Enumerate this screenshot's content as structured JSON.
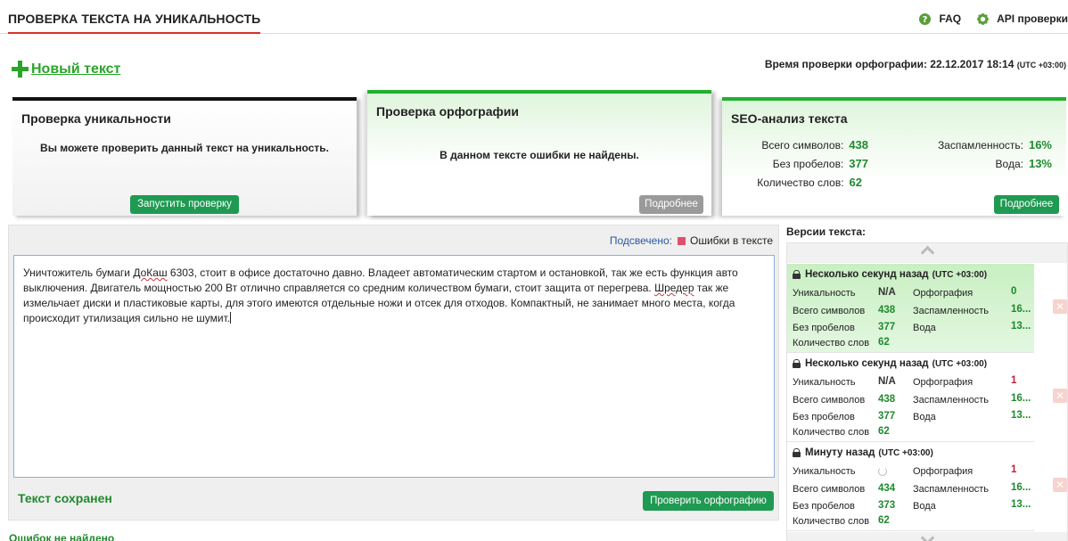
{
  "header": {
    "title": "ПРОВЕРКА ТЕКСТА НА УНИКАЛЬНОСТЬ",
    "links": [
      {
        "label": "FAQ",
        "icon": "question-icon"
      },
      {
        "label": "API проверки",
        "icon": "gear-icon"
      }
    ]
  },
  "new_text": {
    "label": "Новый текст",
    "icon": "plus-icon"
  },
  "spell_time": {
    "label": "Время проверки орфографии: 22.12.2017 18:14",
    "utc": "(UTC +03:00)"
  },
  "cards": {
    "unique": {
      "title": "Проверка уникальности",
      "message": "Вы можете проверить данный текст на уникальность.",
      "button": "Запустить проверку"
    },
    "spell": {
      "title": "Проверка орфографии",
      "message": "В данном тексте ошибки не найдены.",
      "button": "Подробнее"
    },
    "seo": {
      "title": "SEO-анализ текста",
      "total_chars_label": "Всего символов:",
      "total_chars": "438",
      "no_spaces_label": "Без пробелов:",
      "no_spaces": "377",
      "words_label": "Количество слов:",
      "words": "62",
      "spam_label": "Заспамленность:",
      "spam": "16%",
      "water_label": "Вода:",
      "water": "13%",
      "button": "Подробнее"
    }
  },
  "editor": {
    "highlight_label": "Подсвечено:",
    "legend_errors": "Ошибки в тексте",
    "text_parts": {
      "p1": "Уничтожитель бумаги ",
      "w1": "ДоКаш",
      "p2": " 6303, стоит в офисе достаточно давно. Владеет автоматическим стартом и остановкой, так же есть функция авто выключения. Двигатель мощностью 200 Вт отлично справляется со средним количеством бумаги, стоит защита от перегрева. ",
      "w2": "Шредер",
      "p3": " так же измельчает диски и пластиковые карты, для этого имеются отдельные ножи и отсек для отходов. Компактный, не занимает много места, когда происходит утилизация сильно не шумит."
    },
    "status": "Текст сохранен",
    "check_button": "Проверить орфографию",
    "no_errors": "Ошибок не найдено"
  },
  "versions": {
    "title": "Версии текста:",
    "labels": {
      "unique": "Уникальность",
      "spell": "Орфография",
      "total": "Всего символов",
      "spam": "Заспамленность",
      "nospace": "Без пробелов",
      "water": "Вода",
      "words": "Количество слов"
    },
    "items": [
      {
        "time": "Несколько секунд назад",
        "utc": "(UTC +03:00)",
        "unique": "N/A",
        "spell": "0",
        "total": "438",
        "spam": "16...",
        "nospace": "377",
        "water": "13...",
        "words": "62",
        "active": true
      },
      {
        "time": "Несколько секунд назад",
        "utc": "(UTC +03:00)",
        "unique": "N/A",
        "spell": "1",
        "total": "438",
        "spam": "16...",
        "nospace": "377",
        "water": "13...",
        "words": "62",
        "active": false
      },
      {
        "time": "Минуту назад",
        "utc": "(UTC +03:00)",
        "unique": "",
        "spell": "1",
        "total": "434",
        "spam": "16...",
        "nospace": "373",
        "water": "13...",
        "words": "62",
        "active": false
      }
    ],
    "delete_glyph": "✕"
  },
  "colors": {
    "accent_green": "#1f9a52",
    "title_underline": "#d9302c",
    "error": "#e0506c"
  }
}
